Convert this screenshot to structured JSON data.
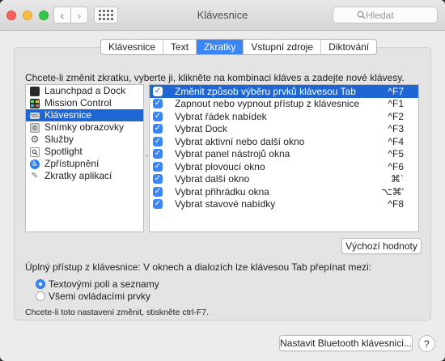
{
  "window": {
    "title": "Klávesnice",
    "search_placeholder": "Hledat"
  },
  "tabs": [
    {
      "label": "Klávesnice",
      "active": false
    },
    {
      "label": "Text",
      "active": false
    },
    {
      "label": "Zkratky",
      "active": true
    },
    {
      "label": "Vstupní zdroje",
      "active": false
    },
    {
      "label": "Diktování",
      "active": false
    }
  ],
  "instructions": "Chcete-li změnit zkratku, vyberte ji, klikněte na kombinaci kláves a zadejte nové klávesy.",
  "categories": [
    {
      "label": "Launchpad a Dock",
      "icon": "launchpad-icon"
    },
    {
      "label": "Mission Control",
      "icon": "mission-control-icon"
    },
    {
      "label": "Klávesnice",
      "icon": "keyboard-icon",
      "selected": true
    },
    {
      "label": "Snímky obrazovky",
      "icon": "screenshot-icon"
    },
    {
      "label": "Služby",
      "icon": "services-gear-icon"
    },
    {
      "label": "Spotlight",
      "icon": "spotlight-icon"
    },
    {
      "label": "Zpřístupnění",
      "icon": "accessibility-icon"
    },
    {
      "label": "Zkratky aplikací",
      "icon": "app-shortcuts-icon"
    }
  ],
  "shortcuts": [
    {
      "label": "Změnit způsob výběru prvků klávesou Tab",
      "key": "^F7",
      "checked": true,
      "selected": true
    },
    {
      "label": "Zapnout nebo vypnout přístup z klávesnice",
      "key": "^F1",
      "checked": true
    },
    {
      "label": "Vybrat řádek nabídek",
      "key": "^F2",
      "checked": true
    },
    {
      "label": "Vybrat Dock",
      "key": "^F3",
      "checked": true
    },
    {
      "label": "Vybrat aktivní nebo další okno",
      "key": "^F4",
      "checked": true
    },
    {
      "label": "Vybrat panel nástrojů okna",
      "key": "^F5",
      "checked": true
    },
    {
      "label": "Vybrat plovoucí okno",
      "key": "^F6",
      "checked": true
    },
    {
      "label": "Vybrat další okno",
      "key": "⌘`",
      "checked": true
    },
    {
      "label": "Vybrat přihrádku okna",
      "key": "⌥⌘'",
      "checked": true
    },
    {
      "label": "Vybrat stavové nabídky",
      "key": "^F8",
      "checked": true
    }
  ],
  "default_button": "Výchozí hodnoty",
  "full_access": {
    "label": "Úplný přístup z klávesnice: V oknech a dialozích lze klávesou Tab přepínat mezi:",
    "options": [
      {
        "label": "Textovými poli a seznamy",
        "selected": true
      },
      {
        "label": "Všemi ovládacími prvky",
        "selected": false
      }
    ],
    "note": "Chcete-li toto nastavení změnit, stiskněte ctrl-F7."
  },
  "bluetooth_button": "Nastavit Bluetooth klávesnici...",
  "help_label": "?"
}
